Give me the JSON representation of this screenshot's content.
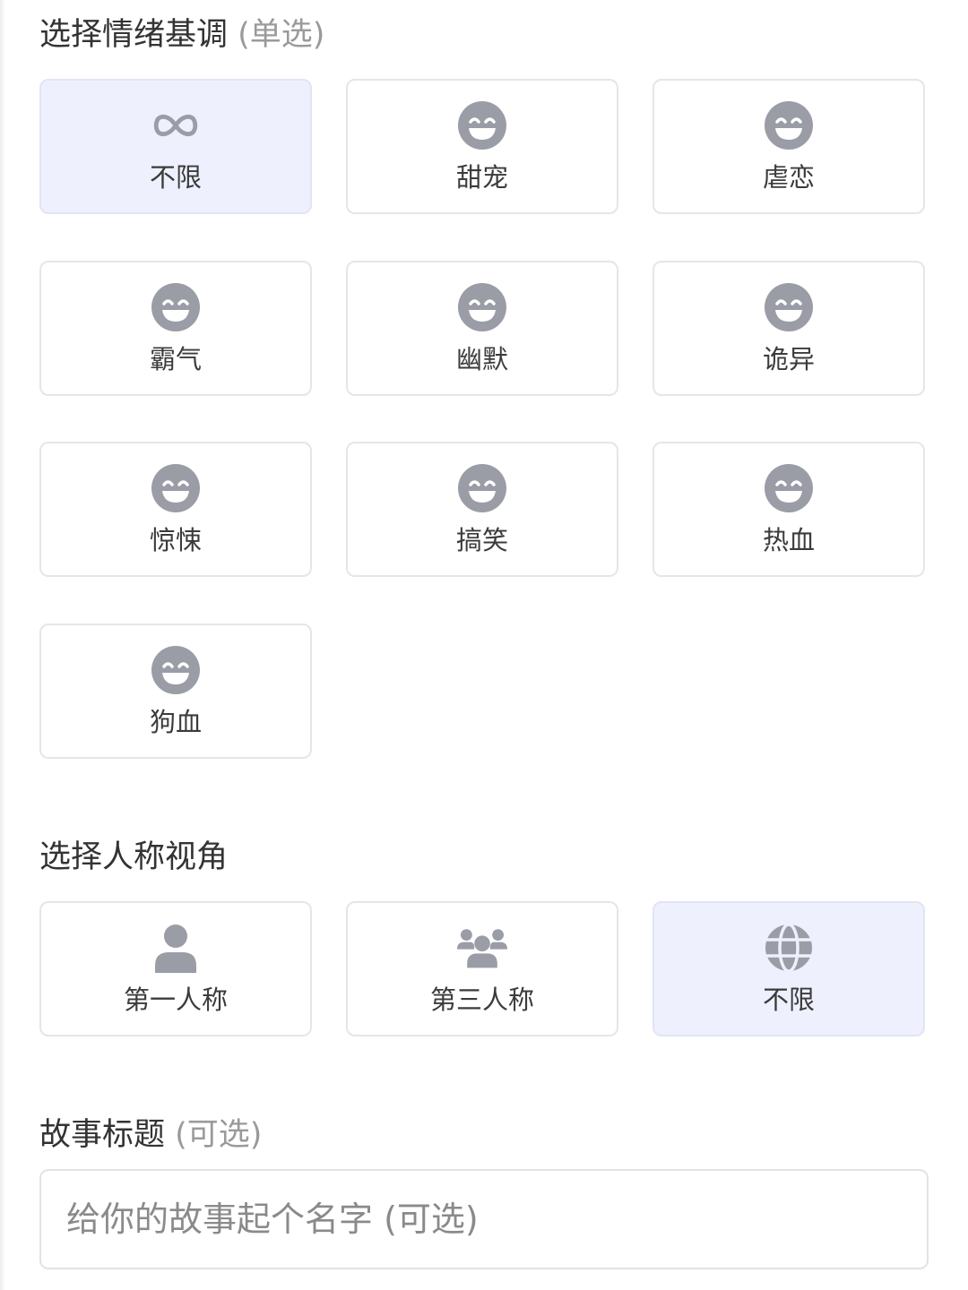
{
  "tone_section": {
    "title": "选择情绪基调",
    "hint": "(单选)",
    "options": [
      {
        "label": "不限",
        "icon": "infinity-icon",
        "selected": true
      },
      {
        "label": "甜宠",
        "icon": "smiley-icon",
        "selected": false
      },
      {
        "label": "虐恋",
        "icon": "smiley-icon",
        "selected": false
      },
      {
        "label": "霸气",
        "icon": "smiley-icon",
        "selected": false
      },
      {
        "label": "幽默",
        "icon": "smiley-icon",
        "selected": false
      },
      {
        "label": "诡异",
        "icon": "smiley-icon",
        "selected": false
      },
      {
        "label": "惊悚",
        "icon": "smiley-icon",
        "selected": false
      },
      {
        "label": "搞笑",
        "icon": "smiley-icon",
        "selected": false
      },
      {
        "label": "热血",
        "icon": "smiley-icon",
        "selected": false
      },
      {
        "label": "狗血",
        "icon": "smiley-icon",
        "selected": false
      }
    ]
  },
  "perspective_section": {
    "title": "选择人称视角",
    "options": [
      {
        "label": "第一人称",
        "icon": "person-icon",
        "selected": false
      },
      {
        "label": "第三人称",
        "icon": "group-icon",
        "selected": false
      },
      {
        "label": "不限",
        "icon": "globe-icon",
        "selected": true
      }
    ]
  },
  "story_title": {
    "title": "故事标题",
    "hint": "(可选)",
    "value": "",
    "placeholder": "给你的故事起个名字 (可选)"
  },
  "colors": {
    "selected_background": "#eef1fd",
    "card_border": "#e6e6e9",
    "icon_gray": "#9a9ca6",
    "text": "#333333",
    "hint_text": "#9a9a9a"
  }
}
